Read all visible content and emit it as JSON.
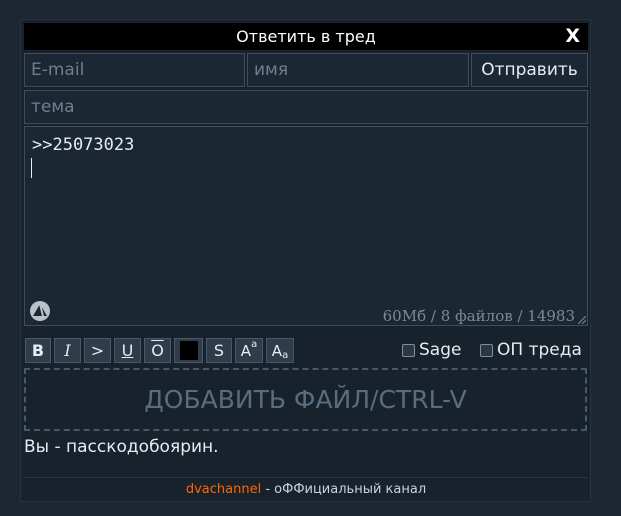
{
  "window": {
    "title": "Ответить в тред",
    "close_label": "X"
  },
  "form": {
    "email_placeholder": "E-mail",
    "name_placeholder": "имя",
    "send_label": "Отправить",
    "subject_placeholder": "тема",
    "message_text": ">>25073023",
    "limits_text": "60Мб / 8 файлов / 14983"
  },
  "toolbar": {
    "bold": "B",
    "italic": "I",
    "quote": ">",
    "underline": "U",
    "overline": "O",
    "strike": "S",
    "sup_base": "A",
    "sup_small": "a",
    "sub_base": "A",
    "sub_small": "a",
    "sage_label": "Sage",
    "op_label": "ОП треда"
  },
  "dropzone": {
    "label": "ДОБАВИТЬ ФАЙЛ/CTRL-V"
  },
  "passcode_text": "Вы - пасскодобоярин.",
  "footer": {
    "link_text": "dvachannel",
    "rest_text": " - оФФициальный канал"
  },
  "colors": {
    "background": "#1c2733",
    "panel": "#18222c",
    "field_bg": "#1b2833",
    "field_border": "#3c4d5c",
    "text": "#e6ecf1",
    "muted": "#6f7f8e",
    "link": "#ff6600"
  },
  "icons": {
    "close": "close-icon",
    "logo": "triangle-logo-icon",
    "resize": "resize-grip-icon"
  }
}
